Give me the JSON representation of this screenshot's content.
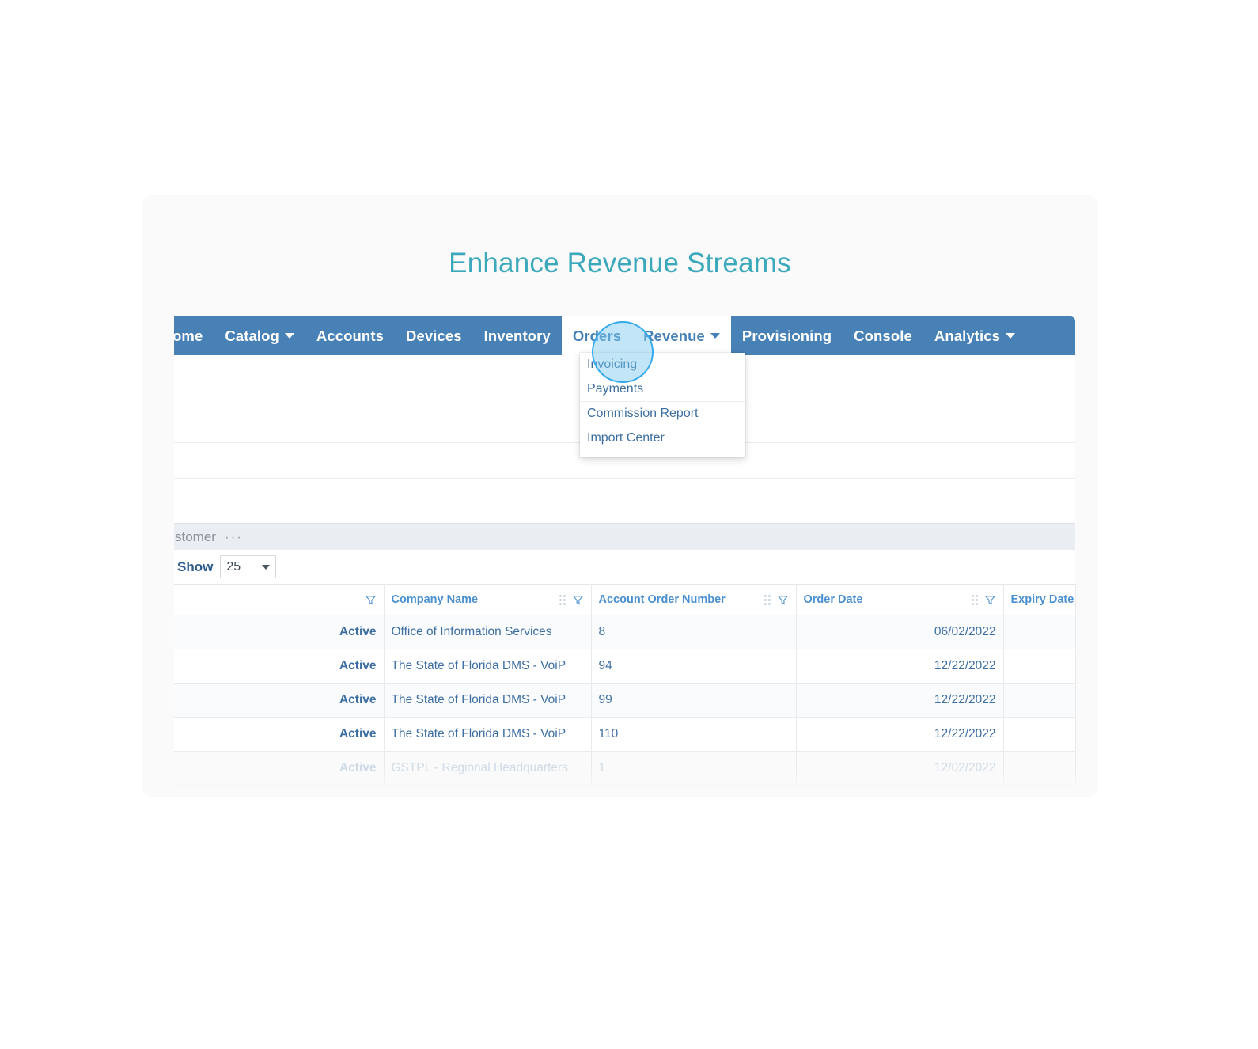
{
  "page": {
    "title": "Enhance Revenue Streams",
    "title_color": "#3ba8bc",
    "nav_color": "#4781b6"
  },
  "nav": {
    "items": [
      {
        "label": "ome",
        "has_caret": false,
        "state": "normal"
      },
      {
        "label": "Catalog",
        "has_caret": true,
        "state": "normal"
      },
      {
        "label": "Accounts",
        "has_caret": false,
        "state": "normal"
      },
      {
        "label": "Devices",
        "has_caret": false,
        "state": "normal"
      },
      {
        "label": "Inventory",
        "has_caret": false,
        "state": "normal"
      },
      {
        "label": "Orders",
        "has_caret": false,
        "state": "active"
      },
      {
        "label": "Revenue",
        "has_caret": true,
        "state": "open"
      },
      {
        "label": "Provisioning",
        "has_caret": false,
        "state": "normal"
      },
      {
        "label": "Console",
        "has_caret": false,
        "state": "normal"
      },
      {
        "label": "Analytics",
        "has_caret": true,
        "state": "normal"
      }
    ]
  },
  "dropdown": {
    "parent": "Revenue",
    "items": [
      {
        "label": "Invoicing"
      },
      {
        "label": "Payments"
      },
      {
        "label": "Commission Report"
      },
      {
        "label": "Import Center"
      }
    ]
  },
  "highlight": {
    "target": "Revenue",
    "fill": "#78c8f0",
    "border": "#33a9ee"
  },
  "breadcrumb": {
    "label": "stomer",
    "overflow": "···"
  },
  "toolbar": {
    "show_label": "Show",
    "show_value": "25"
  },
  "table": {
    "columns": [
      {
        "label": "",
        "filter": true,
        "drag": false
      },
      {
        "label": "Company Name",
        "filter": true,
        "drag": true
      },
      {
        "label": "Account Order Number",
        "filter": true,
        "drag": true
      },
      {
        "label": "Order Date",
        "filter": true,
        "drag": true
      },
      {
        "label": "Expiry Date",
        "filter": false,
        "drag": false
      }
    ],
    "rows": [
      {
        "status": "Active",
        "company": "Office of Information Services",
        "order_number": "8",
        "order_date": "06/02/2022",
        "expiry_date": ""
      },
      {
        "status": "Active",
        "company": "The State of Florida DMS - VoiP",
        "order_number": "94",
        "order_date": "12/22/2022",
        "expiry_date": ""
      },
      {
        "status": "Active",
        "company": "The State of Florida DMS - VoiP",
        "order_number": "99",
        "order_date": "12/22/2022",
        "expiry_date": ""
      },
      {
        "status": "Active",
        "company": "The State of Florida DMS - VoiP",
        "order_number": "110",
        "order_date": "12/22/2022",
        "expiry_date": ""
      },
      {
        "status": "Active",
        "company": "GSTPL - Regional Headquarters",
        "order_number": "1",
        "order_date": "12/02/2022",
        "expiry_date": ""
      }
    ],
    "status_color": "#3d9c3d",
    "link_color": "#4a90d0"
  }
}
